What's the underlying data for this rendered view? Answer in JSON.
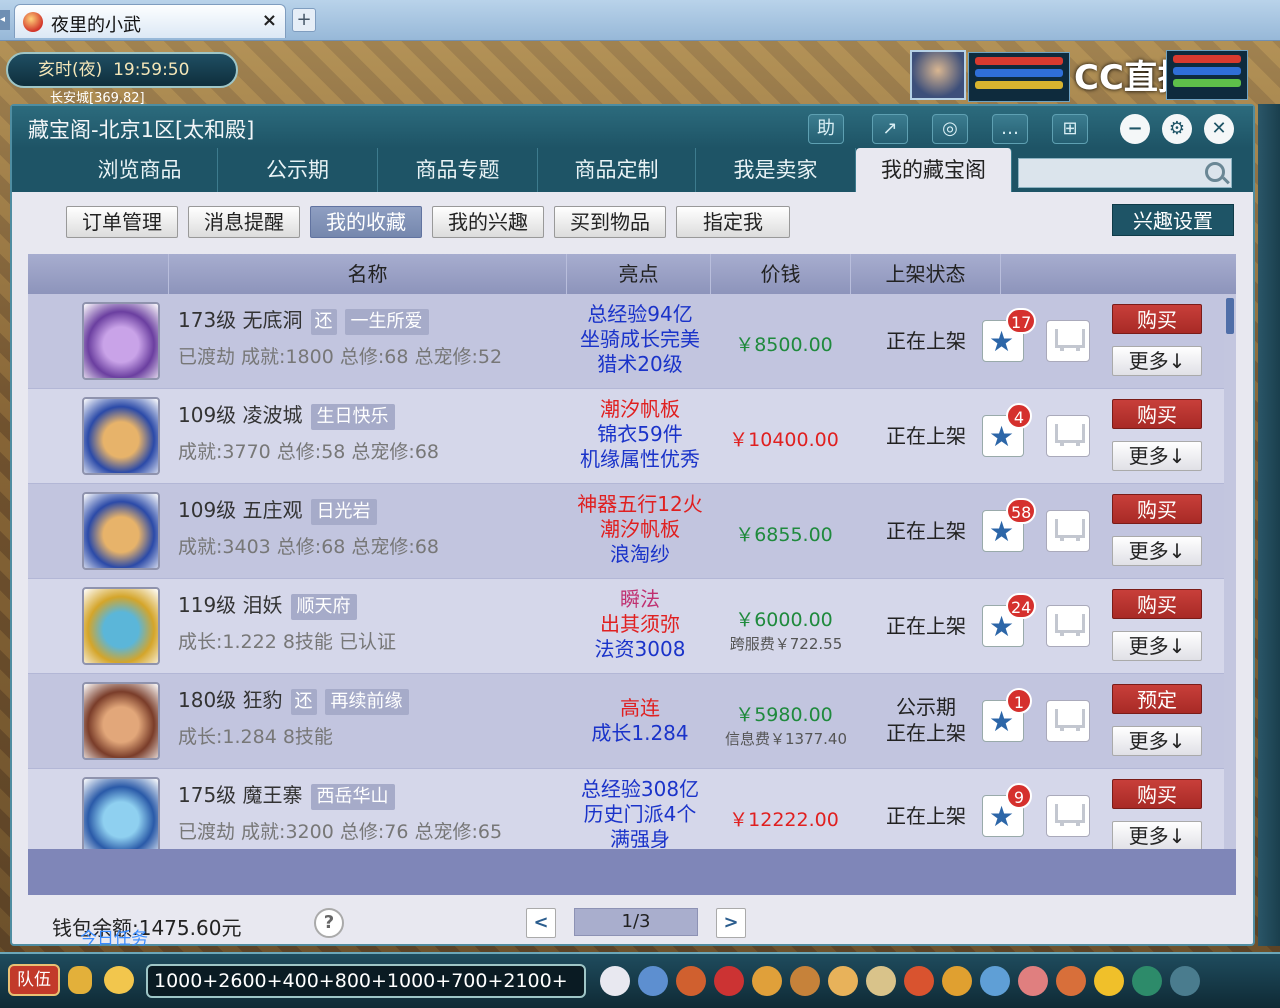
{
  "browser": {
    "tab_title": "夜里的小武",
    "close_glyph": "×",
    "new_tab_glyph": "+"
  },
  "hud": {
    "time": "亥时(夜)  19:59:50",
    "location": "长安城[369,82]",
    "stream_logo": "CC直播"
  },
  "window": {
    "title": "藏宝阁-北京1区[太和殿]",
    "toolbar_buttons": [
      "助",
      "↗",
      "◎",
      "…",
      "⊞"
    ],
    "nav_tabs": [
      "浏览商品",
      "公示期",
      "商品专题",
      "商品定制",
      "我是卖家",
      "我的藏宝阁"
    ],
    "active_tab": "我的藏宝阁",
    "search_placeholder": ""
  },
  "sub_nav": {
    "buttons": [
      "订单管理",
      "消息提醒",
      "我的收藏",
      "我的兴趣",
      "买到物品",
      "指定我"
    ],
    "active": "我的收藏",
    "interest_settings": "兴趣设置"
  },
  "table": {
    "columns": [
      "名称",
      "亮点",
      "价钱",
      "上架状态"
    ],
    "rows": [
      {
        "level_name": "173级  无底洞",
        "tags": [
          "还",
          "一生所爱"
        ],
        "info": "已渡劫 成就:1800 总修:68 总宠修:52",
        "highlights": [
          "总经验94亿",
          "坐骑成长完美",
          "猎术20级"
        ],
        "hl_colors": [
          "#1a33c9",
          "#1a33c9",
          "#1a33c9"
        ],
        "price": "￥8500.00",
        "price_color": "#1f8a3d",
        "fee": "",
        "status": [
          "正在上架"
        ],
        "favorites": "17",
        "buy_label": "购买",
        "more_label": "更多↓"
      },
      {
        "level_name": "109级  凌波城",
        "tags": [
          "生日快乐"
        ],
        "info": "成就:3770 总修:58 总宠修:68",
        "highlights": [
          "潮汐帆板",
          "锦衣59件",
          "机缘属性优秀"
        ],
        "hl_colors": [
          "#e02020",
          "#1a33c9",
          "#1a33c9"
        ],
        "price": "￥10400.00",
        "price_color": "#e02020",
        "fee": "",
        "status": [
          "正在上架"
        ],
        "favorites": "4",
        "buy_label": "购买",
        "more_label": "更多↓"
      },
      {
        "level_name": "109级  五庄观",
        "tags": [
          "日光岩"
        ],
        "info": "成就:3403 总修:68 总宠修:68",
        "highlights": [
          "神器五行12火",
          "潮汐帆板",
          "浪淘纱"
        ],
        "hl_colors": [
          "#e02020",
          "#e02020",
          "#1a33c9"
        ],
        "price": "￥6855.00",
        "price_color": "#1f8a3d",
        "fee": "",
        "status": [
          "正在上架"
        ],
        "favorites": "58",
        "buy_label": "购买",
        "more_label": "更多↓"
      },
      {
        "level_name": "119级  泪妖",
        "tags": [
          "顺天府"
        ],
        "info": "成长:1.222 8技能 已认证",
        "highlights": [
          "瞬法",
          "出其须弥",
          "法资3008"
        ],
        "hl_colors": [
          "#c03070",
          "#e02020",
          "#1a33c9"
        ],
        "price": "￥6000.00",
        "price_color": "#1f8a3d",
        "fee": "跨服费￥722.55",
        "status": [
          "正在上架"
        ],
        "favorites": "24",
        "buy_label": "购买",
        "more_label": "更多↓"
      },
      {
        "level_name": "180级  狂豹",
        "tags": [
          "还",
          "再续前缘"
        ],
        "info": "成长:1.284 8技能",
        "highlights": [
          "高连",
          "成长1.284"
        ],
        "hl_colors": [
          "#e02020",
          "#1a33c9"
        ],
        "price": "￥5980.00",
        "price_color": "#1f8a3d",
        "fee": "信息费￥1377.40",
        "status": [
          "公示期",
          "正在上架"
        ],
        "favorites": "1",
        "buy_label": "预定",
        "more_label": "更多↓"
      },
      {
        "level_name": "175级  魔王寨",
        "tags": [
          "西岳华山"
        ],
        "info": "已渡劫 成就:3200 总修:76 总宠修:65",
        "highlights": [
          "总经验308亿",
          "历史门派4个",
          "满强身"
        ],
        "hl_colors": [
          "#1a33c9",
          "#1a33c9",
          "#1a33c9"
        ],
        "price": "￥12222.00",
        "price_color": "#e02020",
        "fee": "",
        "status": [
          "正在上架"
        ],
        "favorites": "9",
        "buy_label": "购买",
        "more_label": "更多↓"
      }
    ]
  },
  "footer": {
    "wallet": "钱包余额:1475.60元",
    "task_overlay": "今日任务",
    "help": "?",
    "prev": "<",
    "page": "1/3",
    "next": ">"
  },
  "bottom_bar": {
    "team": "队伍",
    "chat_text": "1000+2600+400+800+1000+700+2100+"
  }
}
